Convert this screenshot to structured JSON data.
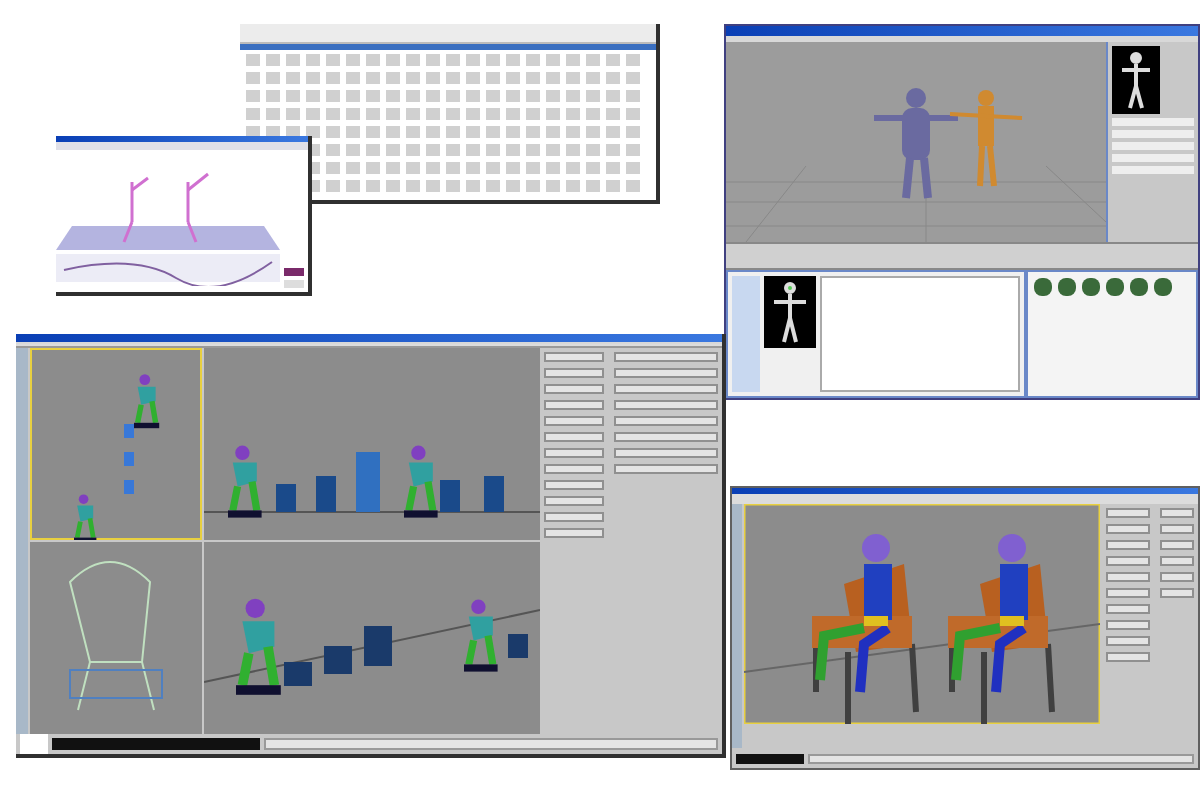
{
  "windows": [
    {
      "kind": "spreadsheet"
    },
    {
      "kind": "curve-editor"
    },
    {
      "kind": "character-setup"
    },
    {
      "kind": "quad-viewport"
    },
    {
      "kind": "single-viewport"
    }
  ]
}
